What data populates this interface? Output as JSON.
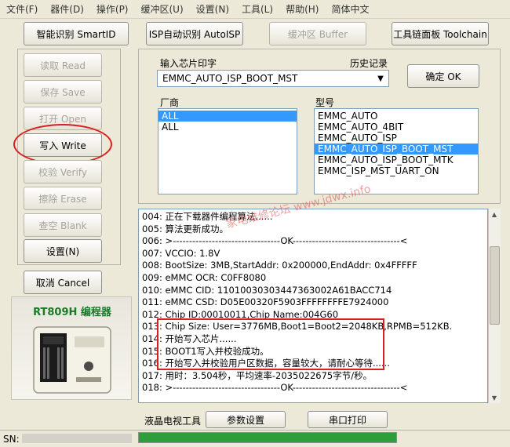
{
  "menu": [
    "文件(F)",
    "器件(D)",
    "操作(P)",
    "缓冲区(U)",
    "设置(N)",
    "工具(L)",
    "帮助(H)",
    "简体中文"
  ],
  "toolbar": {
    "smart_id": "智能识别 SmartID",
    "auto_isp": "ISP自动识别 AutoISP",
    "buffer": "缓冲区 Buffer",
    "toolchain": "工具链面板 Toolchain"
  },
  "ops": {
    "read": "读取 Read",
    "save": "保存 Save",
    "open": "打开 Open",
    "write": "写入 Write",
    "verify": "校验 Verify",
    "erase": "擦除 Erase",
    "blank": "查空 Blank",
    "settings": "设置(N)",
    "cancel": "取消 Cancel"
  },
  "device": {
    "label": "RT809H 编程器"
  },
  "chip": {
    "input_label": "输入芯片印字",
    "history_label": "历史记录",
    "input_value": "EMMC_AUTO_ISP_BOOT_MST",
    "ok": "确定 OK",
    "vendor_label": "厂商",
    "vendors": [
      "ALL",
      "ALL"
    ],
    "vendor_selected": 0,
    "model_label": "型号",
    "models": [
      "EMMC_AUTO",
      "EMMC_AUTO_4BIT",
      "EMMC_AUTO_ISP",
      "EMMC_AUTO_ISP_BOOT_MST",
      "EMMC_AUTO_ISP_BOOT_MTK",
      "EMMC_ISP_MST_UART_ON"
    ],
    "model_selected": 3
  },
  "log": [
    "004: 正在下载器件编程算法......",
    "005: 算法更新成功。",
    "006: >---------------------------------OK---------------------------------<",
    "007: VCCIO: 1.8V",
    "008: BootSize: 3MB,StartAddr: 0x200000,EndAddr: 0x4FFFFF",
    "009: eMMC OCR: C0FF8080",
    "010: eMMC CID:  11010030303447363002A61BACC714",
    "011: eMMC CSD: D05E00320F5903FFFFFFFFE7924000",
    "012: Chip ID:00010011,Chip Name:004G60",
    "013: Chip Size: User=3776MB,Boot1=Boot2=2048KB,RPMB=512KB.",
    "014: 开始写入芯片......",
    "015: BOOT1写入并校验成功。",
    "016:  开始写入并校验用户区数据，容量较大，请耐心等待......",
    "017: 用时：3.504秒，平均速率-2035022675字节/秒。",
    "018: >---------------------------------OK---------------------------------<"
  ],
  "bottom": {
    "tv_tools": "液晶电视工具",
    "params": "参数设置",
    "serial_print": "串口打印",
    "sn_label": "SN:"
  },
  "progress": {
    "value": 1.0,
    "color": "#2e9e3a"
  },
  "colors": {
    "highlight_red": "#d82020",
    "selection": "#3399ff"
  }
}
